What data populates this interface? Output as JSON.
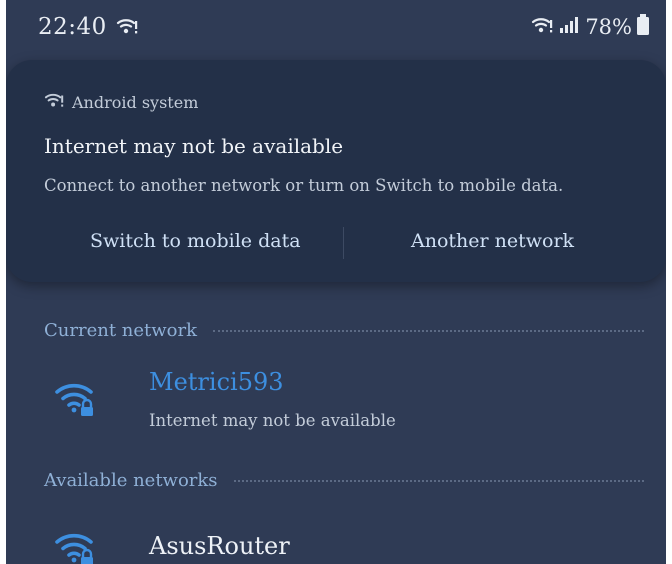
{
  "status_bar": {
    "time": "22:40",
    "battery": "78%",
    "icons": [
      "wifi-alert-icon",
      "wifi-icon",
      "signal-icon",
      "battery-icon"
    ]
  },
  "notification": {
    "app_name": "Android system",
    "app_icon": "wifi-alert-icon",
    "title": "Internet may not be available",
    "body": "Connect to another network or turn on Switch to mobile data.",
    "actions": {
      "mobile_data": "Switch to mobile data",
      "another_network": "Another network"
    }
  },
  "current_network": {
    "header": "Current network",
    "name": "Metrici593",
    "status": "Internet may not be available",
    "icon": "wifi-lock-icon"
  },
  "available_networks": {
    "header": "Available networks",
    "items": [
      {
        "name": "AsusRouter",
        "icon": "wifi-lock-icon"
      }
    ]
  },
  "colors": {
    "background": "#2f3b55",
    "card": "#233048",
    "accent_blue": "#3d8fe0",
    "section_label": "#8fb0d6"
  }
}
